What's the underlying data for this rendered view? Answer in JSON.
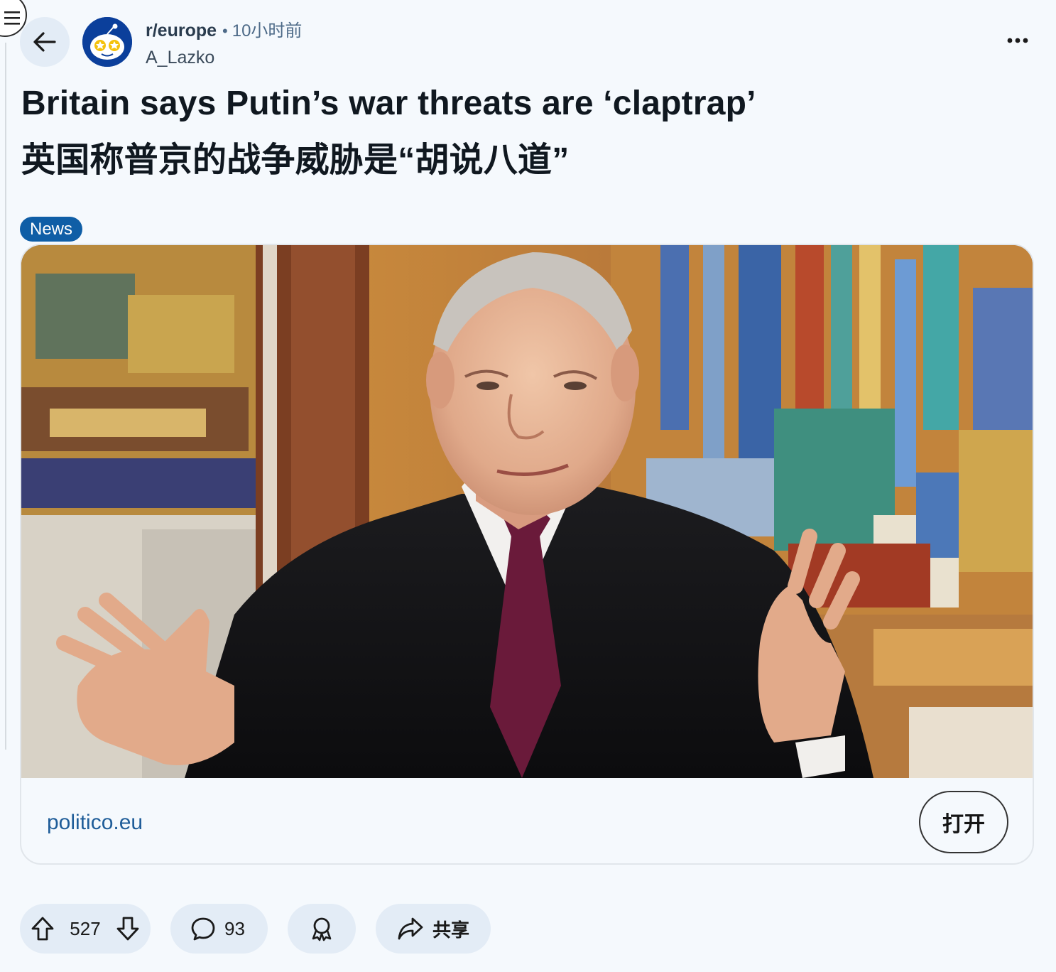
{
  "post": {
    "subreddit": "r/europe",
    "separator": "•",
    "time_ago": "10小时前",
    "author": "A_Lazko",
    "title_en": "Britain says Putin’s war threats are ‘claptrap’",
    "title_zh": "英国称普京的战争威胁是“胡说八道”",
    "flair": "News",
    "flair_color": "#0f5ea6"
  },
  "link_card": {
    "domain": "politico.eu",
    "open_label": "打开"
  },
  "actions": {
    "upvotes": "527",
    "comments": "93",
    "share_label": "共享"
  },
  "icons": {
    "menu": "hamburger-menu-icon",
    "back": "arrow-left-icon",
    "more": "more-horizontal-icon",
    "upvote": "arrow-up-icon",
    "downvote": "arrow-down-icon",
    "comment": "speech-bubble-icon",
    "award": "award-ribbon-icon",
    "share": "share-arrow-icon"
  },
  "colors": {
    "background": "#f5f9fd",
    "pill_bg": "#e3ecf6",
    "link_text": "#1f5d99"
  }
}
